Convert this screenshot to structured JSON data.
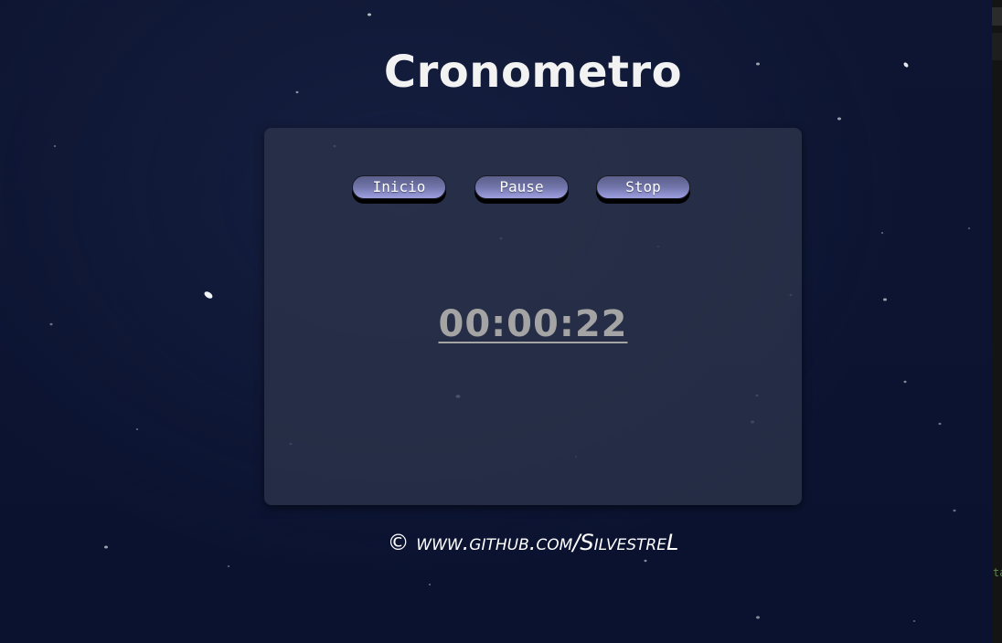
{
  "page": {
    "title": "Cronometro"
  },
  "controls": {
    "start_label": "Inicio",
    "pause_label": "Pause",
    "stop_label": "Stop"
  },
  "timer": {
    "display": "00:00:22"
  },
  "footer": {
    "text": "© www.github.com/SilvestreL"
  },
  "edge": {
    "fragment": "ta"
  },
  "colors": {
    "background": "#0b1330",
    "button_gradient_light": "#9d9fe0",
    "button_gradient_dark": "#5b5f8a",
    "time_text": "#a4a4a4"
  }
}
